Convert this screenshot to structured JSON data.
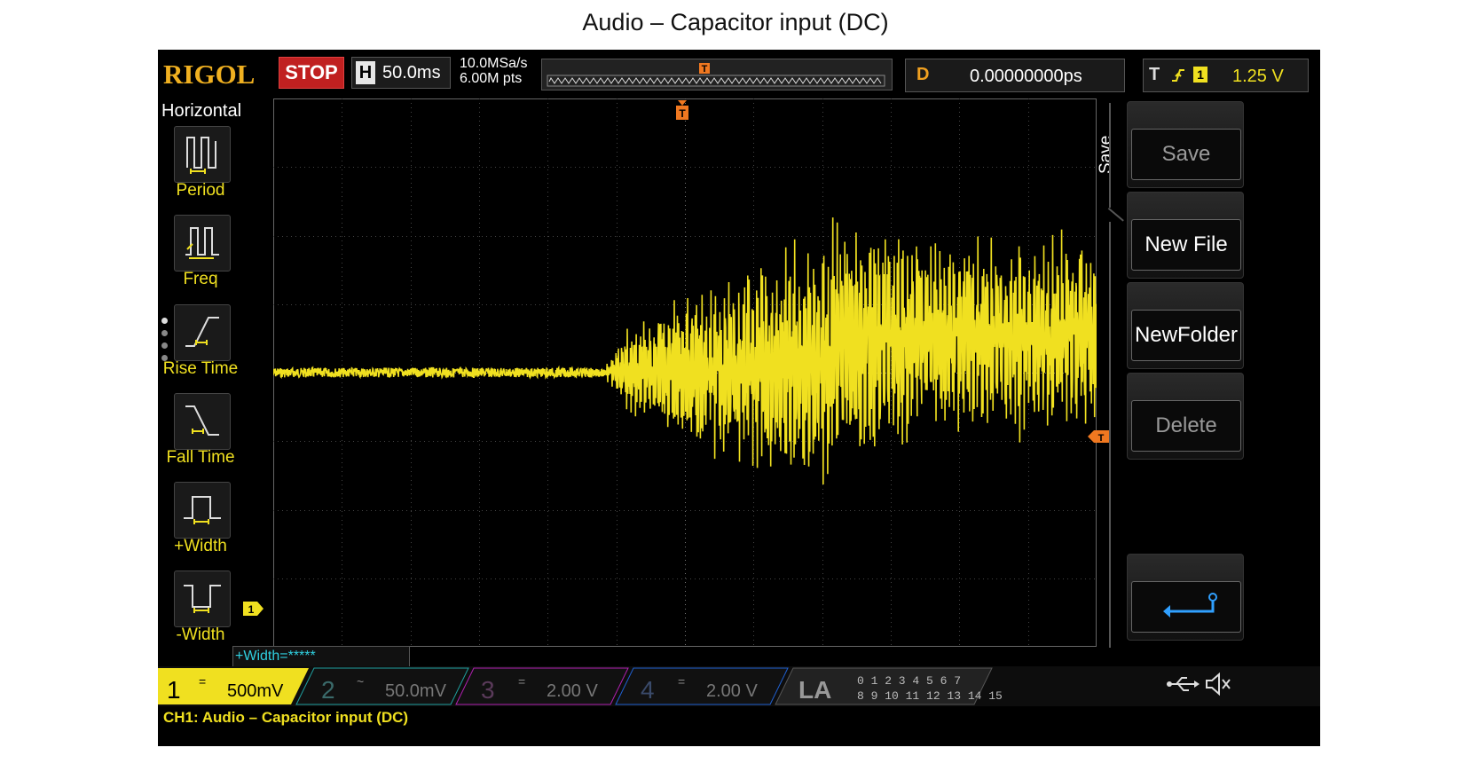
{
  "page": {
    "title": "Audio – Capacitor input (DC)"
  },
  "scope": {
    "logo": "RIGOL",
    "run_state": "STOP",
    "horizontal": {
      "label": "H",
      "timebase": "50.0ms"
    },
    "sample": {
      "rate": "10.0MSa/s",
      "points": "6.00M pts"
    },
    "delay": {
      "label": "D",
      "value": "0.00000000ps"
    },
    "trigger": {
      "label": "T",
      "edge_icon": "rising-edge-icon",
      "source": "1",
      "level": "1.25 V"
    },
    "trigger_marker": "T",
    "ch1_marker": "1",
    "measure_menu": {
      "title": "Horizontal",
      "items": [
        {
          "label": "Period",
          "icon": "period-icon"
        },
        {
          "label": "Freq",
          "icon": "frequency-icon"
        },
        {
          "label": "Rise Time",
          "icon": "rise-time-icon"
        },
        {
          "label": "Fall Time",
          "icon": "fall-time-icon"
        },
        {
          "label": "+Width",
          "icon": "positive-width-icon"
        },
        {
          "label": "-Width",
          "icon": "negative-width-icon"
        }
      ]
    },
    "save_menu": {
      "title": "Save",
      "buttons": [
        {
          "label": "Save",
          "enabled": false
        },
        {
          "label": "New File",
          "enabled": true
        },
        {
          "label": "NewFolder",
          "enabled": true
        },
        {
          "label": "Delete",
          "enabled": false
        }
      ],
      "back_icon": "return-arrow-icon"
    },
    "measurement_readout": "+Width=*****",
    "channels": [
      {
        "num": "1",
        "coupling": "=",
        "scale": "500mV",
        "color": "#f0e020"
      },
      {
        "num": "2",
        "coupling": "~",
        "scale": "50.0mV",
        "color": "#20a0a0"
      },
      {
        "num": "3",
        "coupling": "=",
        "scale": "2.00 V",
        "color": "#b020b0"
      },
      {
        "num": "4",
        "coupling": "=",
        "scale": "2.00 V",
        "color": "#2060d0"
      }
    ],
    "la": {
      "label": "LA",
      "row1": "0 1 2 3  4 5 6 7",
      "row2": "8 9 10 11  12 13 14 15"
    },
    "status_icons": [
      "usb-icon",
      "speaker-mute-icon"
    ],
    "footer_label": "CH1: Audio – Capacitor input (DC)"
  },
  "chart_data": {
    "type": "line",
    "title": "",
    "xlabel": "",
    "ylabel": "",
    "grid": true,
    "x_divisions": 12,
    "y_divisions": 8,
    "series": [
      {
        "color": "#f0e020",
        "envelope_x_div": [
          0,
          4.8,
          5.2,
          6,
          7,
          8,
          8.2,
          9,
          10,
          11,
          12
        ],
        "envelope_upper_div": [
          3.95,
          3.95,
          3.2,
          2.6,
          2.4,
          1.75,
          1.5,
          1.7,
          1.8,
          1.95,
          1.8
        ],
        "envelope_lower_div": [
          4.05,
          4.05,
          4.7,
          5.3,
          5.5,
          5.9,
          5.7,
          5.4,
          5.0,
          5.1,
          5.0
        ]
      }
    ]
  }
}
